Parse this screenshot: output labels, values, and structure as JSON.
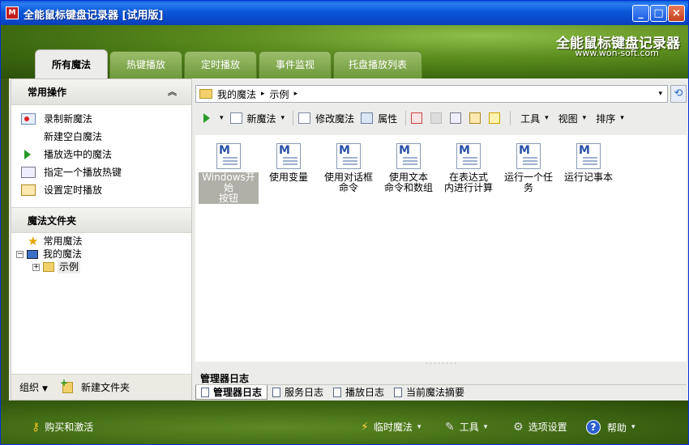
{
  "window": {
    "title": "全能鼠标键盘记录器 [试用版]",
    "app_icon_text": "M",
    "minimize": "_",
    "maximize": "□",
    "close": "×"
  },
  "header": {
    "brand": "全能鼠标键盘记录器",
    "url": "www.won-soft.com",
    "tabs": [
      "所有魔法",
      "热键播放",
      "定时播放",
      "事件监视",
      "托盘播放列表"
    ],
    "active_tab": 0
  },
  "left": {
    "ops_title": "常用操作",
    "ops_collapse": "︽",
    "actions": [
      "录制新魔法",
      "新建空白魔法",
      "播放选中的魔法",
      "指定一个播放热键",
      "设置定时播放"
    ],
    "folders_title": "魔法文件夹",
    "tree": {
      "common": "常用魔法",
      "mine": "我的魔法",
      "example": "示例",
      "minus": "−",
      "plus": "+"
    },
    "bottom": {
      "organize": "组织",
      "new_folder": "新建文件夹"
    }
  },
  "right": {
    "address": {
      "root": "我的魔法",
      "child": "示例",
      "sep": "▸",
      "dropdown": "▾",
      "refresh": "⟲"
    },
    "toolbar": {
      "new": "新魔法",
      "edit": "修改魔法",
      "properties": "属性",
      "tools": "工具",
      "view": "视图",
      "sort": "排序",
      "caret": "▾"
    },
    "files": [
      {
        "line1": "Windows开始",
        "line2": "按钮"
      },
      {
        "line1": "使用变量",
        "line2": ""
      },
      {
        "line1": "使用对话框",
        "line2": "命令"
      },
      {
        "line1": "使用文本",
        "line2": "命令和数组"
      },
      {
        "line1": "在表达式",
        "line2": "内进行计算"
      },
      {
        "line1": "运行一个任",
        "line2": "务"
      },
      {
        "line1": "运行记事本",
        "line2": ""
      }
    ],
    "log_title": "管理器日志",
    "log_tabs": [
      "管理器日志",
      "服务日志",
      "播放日志",
      "当前魔法摘要"
    ]
  },
  "bottombar": {
    "buy": "购买和激活",
    "quick": "临时魔法",
    "tools": "工具",
    "options": "选项设置",
    "help": "帮助",
    "caret": "▾"
  }
}
